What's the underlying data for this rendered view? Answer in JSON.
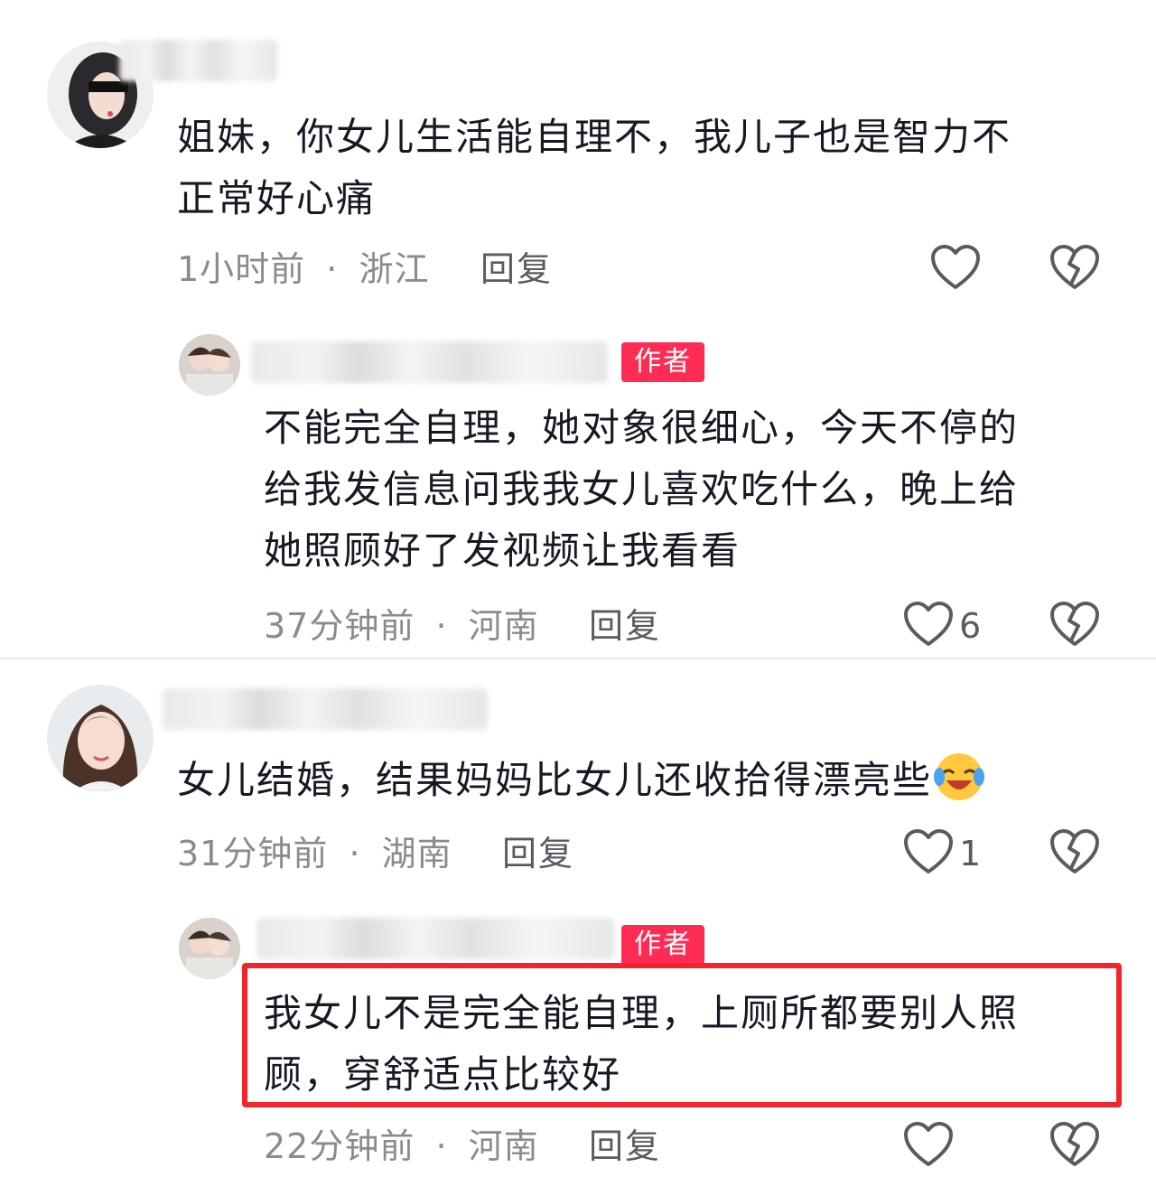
{
  "comments": [
    {
      "text": "姐妹，你女儿生活能自理不，我儿子也是智力不正常好心痛",
      "line1": "姐妹，你女儿生活能自理不，我儿子也是智力不",
      "line2": "正常好心痛",
      "time": "1小时前",
      "location": "浙江",
      "reply_label": "回复",
      "likes": "",
      "reply": {
        "author_badge": "作者",
        "line1": "不能完全自理，她对象很细心，今天不停的",
        "line2": "给我发信息问我我女儿喜欢吃什么，晚上给",
        "line3": "她照顾好了发视频让我看看",
        "time": "37分钟前",
        "location": "河南",
        "reply_label": "回复",
        "likes": "6"
      }
    },
    {
      "line1": "女儿结婚，结果妈妈比女儿还收拾得漂亮些",
      "emoji": "laughing-crying-emoji",
      "time": "31分钟前",
      "location": "湖南",
      "reply_label": "回复",
      "likes": "1",
      "reply": {
        "author_badge": "作者",
        "line1": "我女儿不是完全能自理，上厕所都要别人照",
        "line2": "顾，穿舒适点比较好",
        "time": "22分钟前",
        "location": "河南",
        "reply_label": "回复",
        "likes": ""
      }
    }
  ],
  "separator": "·",
  "colors": {
    "author_badge": "#fe2c55",
    "highlight_box": "#f0262c",
    "meta_text": "#8a8b91",
    "body_text": "#161823"
  },
  "icons": [
    "heart-outline-icon",
    "broken-heart-icon"
  ]
}
